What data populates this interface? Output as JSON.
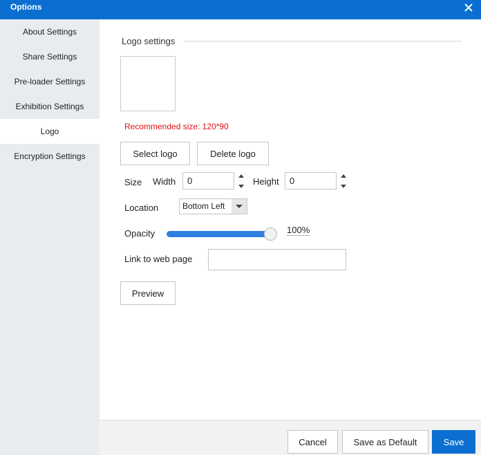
{
  "window": {
    "title": "Options",
    "close_icon": "close-icon"
  },
  "sidebar": {
    "items": [
      {
        "label": "About Settings",
        "active": false
      },
      {
        "label": "Share Settings",
        "active": false
      },
      {
        "label": "Pre-loader Settings",
        "active": false
      },
      {
        "label": "Exhibition Settings",
        "active": false
      },
      {
        "label": "Logo",
        "active": true
      },
      {
        "label": "Encryption Settings",
        "active": false
      }
    ]
  },
  "logo": {
    "section_title": "Logo settings",
    "recommended": "Recommended size: 120*90",
    "select_label": "Select logo",
    "delete_label": "Delete logo",
    "size_label": "Size",
    "width_label": "Width",
    "width_value": "0",
    "height_label": "Height",
    "height_value": "0",
    "location_label": "Location",
    "location_value": "Bottom Left",
    "opacity_label": "Opacity",
    "opacity_value": "100%",
    "opacity_fraction": 1.0,
    "link_label": "Link to web page",
    "link_value": "",
    "preview_label": "Preview"
  },
  "footer": {
    "cancel_label": "Cancel",
    "default_label": "Save as Default",
    "save_label": "Save"
  },
  "colors": {
    "accent": "#0a6fd1",
    "warning": "#e01010",
    "sidebar_bg": "#e8ecf1"
  }
}
